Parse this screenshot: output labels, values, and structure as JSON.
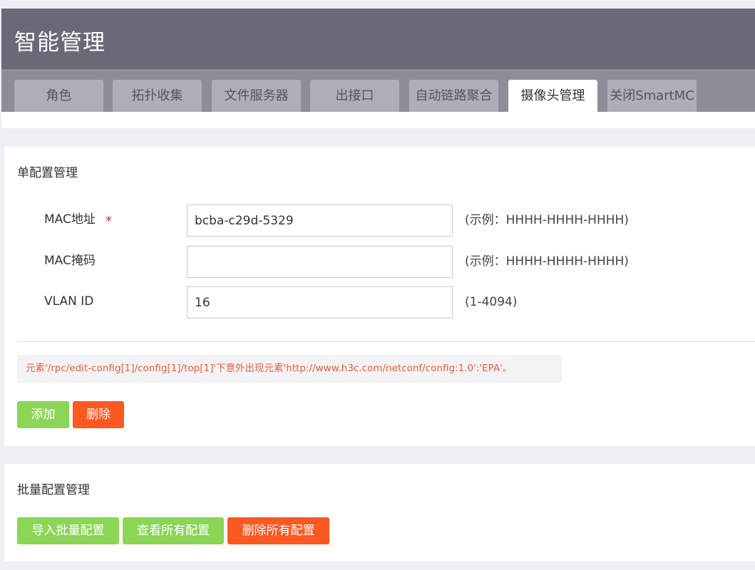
{
  "header": {
    "title": "智能管理",
    "tabs": [
      {
        "label": "角色",
        "active": false
      },
      {
        "label": "拓扑收集",
        "active": false
      },
      {
        "label": "文件服务器",
        "active": false
      },
      {
        "label": "出接口",
        "active": false
      },
      {
        "label": "自动链路聚合",
        "active": false
      },
      {
        "label": "摄像头管理",
        "active": true
      },
      {
        "label": "关闭SmartMC",
        "active": false
      }
    ]
  },
  "single_config": {
    "title": "单配置管理",
    "fields": {
      "mac": {
        "label": "MAC地址",
        "required_mark": "*",
        "value": "bcba-c29d-5329",
        "hint": "(示例：HHHH-HHHH-HHHH)"
      },
      "mask": {
        "label": "MAC掩码",
        "value": "",
        "hint": "(示例：HHHH-HHHH-HHHH)"
      },
      "vlan": {
        "label": "VLAN ID",
        "value": "16",
        "hint": "(1-4094)"
      }
    },
    "error_message": "元素'/rpc/edit-config[1]/config[1]/top[1]'下意外出现元素'http://www.h3c.com/netconf/config:1.0':'EPA'。",
    "buttons": {
      "add": "添加",
      "delete": "删除"
    }
  },
  "batch_config": {
    "title": "批量配置管理",
    "buttons": {
      "import": "导入批量配置",
      "view_all": "查看所有配置",
      "delete_all": "删除所有配置"
    }
  },
  "colors": {
    "header_bg": "#686a77",
    "tab_inactive": "#adaeba",
    "tab_active": "#ffffff",
    "button_green": "#8bd657",
    "button_orange": "#fc5822",
    "error_text": "#e8603c"
  }
}
